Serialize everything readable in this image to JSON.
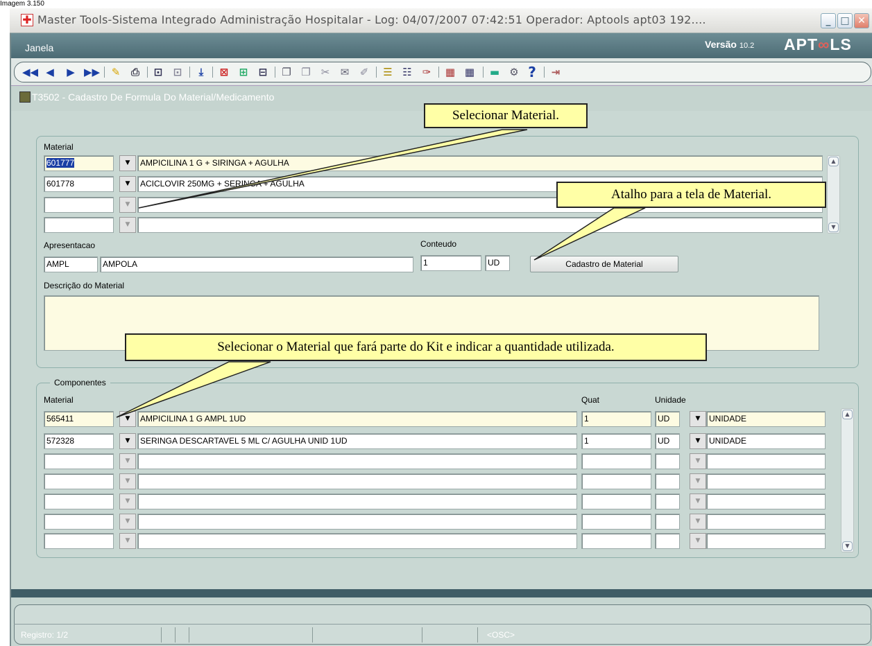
{
  "caption": "Imagem 3.150",
  "window": {
    "title": "Master Tools-Sistema Integrado Administração Hospitalar - Log: 04/07/2007 07:42:51 Operador: Aptools apt03 192...."
  },
  "menubar": {
    "menu_janela": "Janela",
    "version_label": "Versão",
    "version_number": "10.2",
    "logo_text_a": "APT",
    "logo_text_b": "LS"
  },
  "form": {
    "title": "T3502 - Cadastro De Formula Do Material/Medicamento",
    "material_label": "Material",
    "material_rows": [
      {
        "code": "601777",
        "name": "AMPICILINA 1 G + SIRINGA + AGULHA"
      },
      {
        "code": "601778",
        "name": "ACICLOVIR 250MG + SERINGA + AGULHA"
      },
      {
        "code": "",
        "name": ""
      },
      {
        "code": "",
        "name": ""
      }
    ],
    "apresentacao_label": "Apresentacao",
    "apresentacao_code": "AMPL",
    "apresentacao_desc": "AMPOLA",
    "conteudo_label": "Conteudo",
    "conteudo_value": "1",
    "conteudo_unit": "UD",
    "cadastro_button": "Cadastro de Material",
    "descricao_label": "Descrição do Material",
    "descricao_value": ""
  },
  "componentes": {
    "group_label": "Componentes",
    "col_material": "Material",
    "col_quat": "Quat",
    "col_unidade": "Unidade",
    "rows": [
      {
        "code": "565411",
        "name": "AMPICILINA 1 G AMPL 1UD",
        "quat": "1",
        "unit": "UD",
        "unit_desc": "UNIDADE"
      },
      {
        "code": "572328",
        "name": "SERINGA DESCARTAVEL 5 ML C/ AGULHA UNID 1UD",
        "quat": "1",
        "unit": "UD",
        "unit_desc": "UNIDADE"
      },
      {
        "code": "",
        "name": "",
        "quat": "",
        "unit": "",
        "unit_desc": ""
      },
      {
        "code": "",
        "name": "",
        "quat": "",
        "unit": "",
        "unit_desc": ""
      },
      {
        "code": "",
        "name": "",
        "quat": "",
        "unit": "",
        "unit_desc": ""
      },
      {
        "code": "",
        "name": "",
        "quat": "",
        "unit": "",
        "unit_desc": ""
      },
      {
        "code": "",
        "name": "",
        "quat": "",
        "unit": "",
        "unit_desc": ""
      }
    ]
  },
  "callouts": {
    "selecionar_material": "Selecionar Material.",
    "atalho": "Atalho para a tela de Material.",
    "selecionar_kit": "Selecionar o Material que fará parte do Kit e indicar a quantidade utilizada."
  },
  "status": {
    "registro": "Registro: 1/2",
    "mode": "<OSC>"
  },
  "colors": {
    "field_highlight": "#fdfbe2",
    "callout_fill": "#ffffa6",
    "menubar": "#4c6b74",
    "form_background": "#c9d8d3"
  }
}
